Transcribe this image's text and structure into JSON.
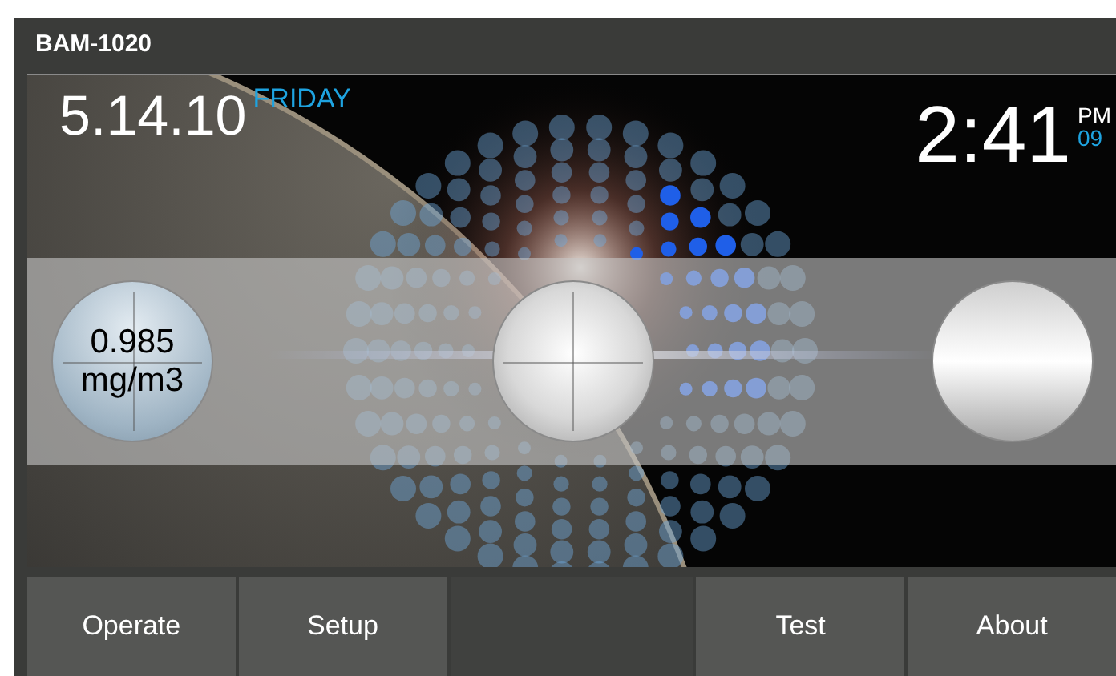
{
  "window": {
    "title": "BAM-1020"
  },
  "date": {
    "value": "5.14.10",
    "weekday": "FRIDAY"
  },
  "clock": {
    "time": "2:41",
    "meridiem": "PM",
    "seconds": "09"
  },
  "dials": [
    {
      "kind": "reading",
      "value": "0.985",
      "unit": "mg/m3"
    },
    {
      "kind": "crosshair"
    },
    {
      "kind": "blank"
    }
  ],
  "buttons": [
    {
      "kind": "button",
      "label": "Operate"
    },
    {
      "kind": "button",
      "label": "Setup"
    },
    {
      "kind": "empty"
    },
    {
      "kind": "button",
      "label": "Test"
    },
    {
      "kind": "button",
      "label": "About"
    }
  ]
}
